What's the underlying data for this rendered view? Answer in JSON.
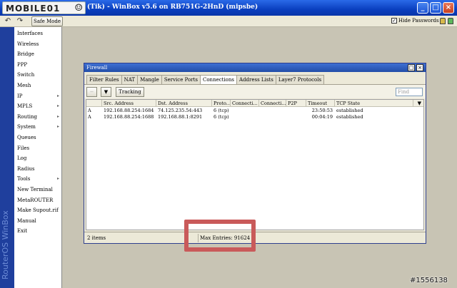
{
  "app": {
    "logo_text": "MOBILE01",
    "title": "(Tik) - WinBox v5.6 on RB751G-2HnD (mipsbe)",
    "brand_vertical": "RouterOS WinBox"
  },
  "toolbar": {
    "safe_mode_label": "Safe Mode",
    "hide_passwords_label": "Hide Passwords",
    "hide_passwords_checked": true
  },
  "menu": {
    "items": [
      {
        "label": "Interfaces",
        "submenu": false
      },
      {
        "label": "Wireless",
        "submenu": false
      },
      {
        "label": "Bridge",
        "submenu": false
      },
      {
        "label": "PPP",
        "submenu": false
      },
      {
        "label": "Switch",
        "submenu": false
      },
      {
        "label": "Mesh",
        "submenu": false
      },
      {
        "label": "IP",
        "submenu": true
      },
      {
        "label": "MPLS",
        "submenu": true
      },
      {
        "label": "Routing",
        "submenu": true
      },
      {
        "label": "System",
        "submenu": true
      },
      {
        "label": "Queues",
        "submenu": false
      },
      {
        "label": "Files",
        "submenu": false
      },
      {
        "label": "Log",
        "submenu": false
      },
      {
        "label": "Radius",
        "submenu": false
      },
      {
        "label": "Tools",
        "submenu": true
      },
      {
        "label": "New Terminal",
        "submenu": false
      },
      {
        "label": "MetaROUTER",
        "submenu": false
      },
      {
        "label": "Make Supout.rif",
        "submenu": false
      },
      {
        "label": "Manual",
        "submenu": false
      },
      {
        "label": "Exit",
        "submenu": false
      }
    ]
  },
  "firewall": {
    "title": "Firewall",
    "tabs": [
      "Filter Rules",
      "NAT",
      "Mangle",
      "Service Ports",
      "Connections",
      "Address Lists",
      "Layer7 Protocols"
    ],
    "active_tab": "Connections",
    "tracking_label": "Tracking",
    "find_placeholder": "Find",
    "columns": [
      "",
      "Src. Address",
      "Dst. Address",
      "Proto...",
      "Connecti...",
      "Connecti...",
      "P2P",
      "Timeout",
      "TCP State"
    ],
    "rows": [
      [
        "A",
        "192.168.88.254:1684",
        "74.125.235.54:443",
        "6 (tcp)",
        "",
        "",
        "",
        "23:50:53",
        "established"
      ],
      [
        "A",
        "192.168.88.254:1688",
        "192.168.88.1:8291",
        "6 (tcp)",
        "",
        "",
        "",
        "00:04:19",
        "established"
      ]
    ],
    "status_items": "2 items",
    "status_max_entries": "Max Entries: 91624"
  },
  "watermark": "#1556138",
  "colors": {
    "titlebar": "#0a3fbf",
    "highlight_box": "#c95a5a",
    "brandbar": "#1f3f9d"
  }
}
